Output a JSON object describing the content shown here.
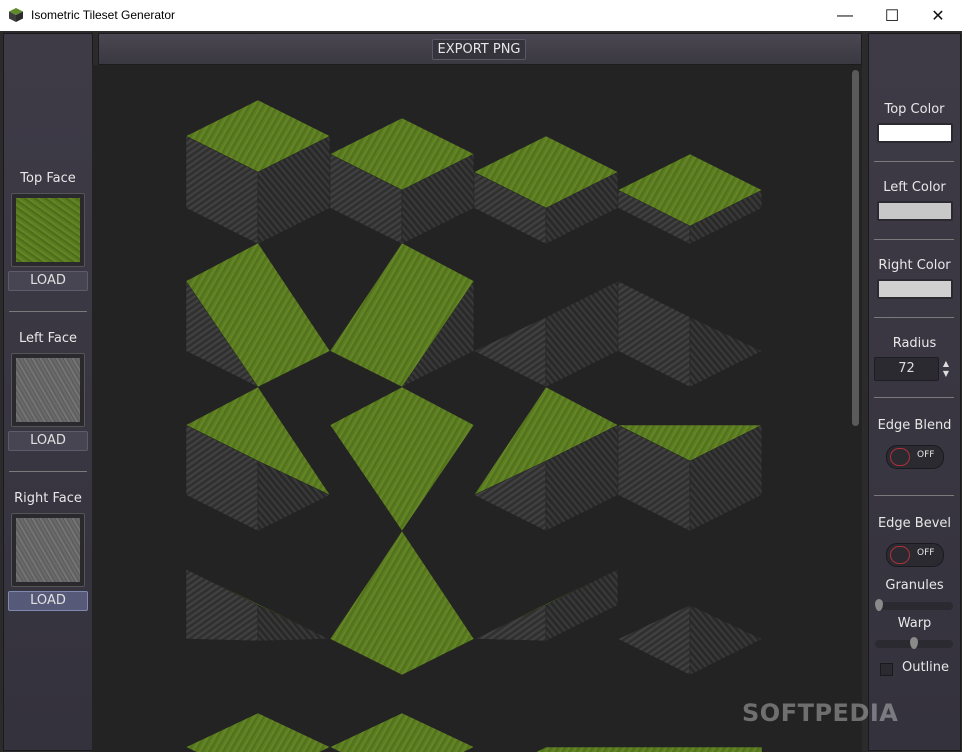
{
  "window": {
    "title": "Isometric Tileset Generator",
    "minimize": "—",
    "maximize": "☐",
    "close": "✕"
  },
  "toolbar": {
    "export_label": "EXPORT PNG"
  },
  "left_panel": {
    "top_face": {
      "label": "Top Face",
      "load_label": "LOAD",
      "texture": "grass"
    },
    "left_face": {
      "label": "Left Face",
      "load_label": "LOAD",
      "texture": "stone"
    },
    "right_face": {
      "label": "Right Face",
      "load_label": "LOAD",
      "texture": "stone"
    }
  },
  "right_panel": {
    "top_color": {
      "label": "Top Color",
      "value": "#ffffff"
    },
    "left_color": {
      "label": "Left Color",
      "value": "#c8c8c8"
    },
    "right_color": {
      "label": "Right Color",
      "value": "#d0d0d0"
    },
    "radius": {
      "label": "Radius",
      "value": "72"
    },
    "edge_blend": {
      "label": "Edge Blend",
      "state": "OFF"
    },
    "edge_bevel": {
      "label": "Edge Bevel",
      "state": "OFF"
    },
    "granules": {
      "label": "Granules",
      "level": 0.0
    },
    "warp": {
      "label": "Warp",
      "level": 0.5
    },
    "outline": {
      "label": "Outline",
      "checked": false
    }
  },
  "watermark": "SOFTPEDIA",
  "colors": {
    "grass": "#5d7d22",
    "stone_left": "#3a3a3a",
    "stone_right": "#323232",
    "accent_border": "#8188b0"
  }
}
